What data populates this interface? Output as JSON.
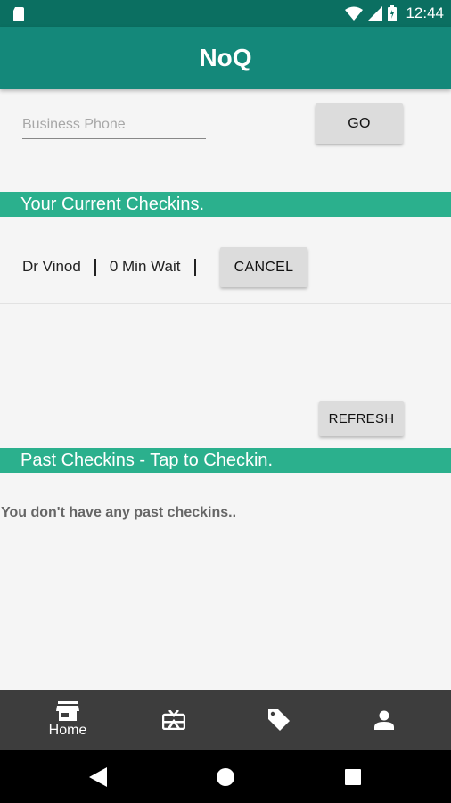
{
  "status_bar": {
    "time": "12:44",
    "icons": [
      "sim-card-icon",
      "wifi-icon",
      "signal-icon",
      "battery-icon"
    ],
    "background": "#0b6f61"
  },
  "app_bar": {
    "title": "NoQ",
    "background": "#14887a"
  },
  "search": {
    "placeholder": "Business Phone",
    "value": "",
    "go_label": "GO"
  },
  "current_checkins": {
    "header": "Your Current Checkins.",
    "items": [
      {
        "name": "Dr Vinod",
        "wait": "0 Min Wait",
        "cancel_label": "CANCEL"
      }
    ]
  },
  "refresh_label": "REFRESH",
  "past_checkins": {
    "header": "Past Checkins - Tap to Checkin.",
    "empty_message": "You don't have any past checkins.."
  },
  "bottom_nav": {
    "items": [
      {
        "label": "Home",
        "icon": "store-icon",
        "selected": true
      },
      {
        "label": "",
        "icon": "gift-card-icon",
        "selected": false
      },
      {
        "label": "",
        "icon": "tag-icon",
        "selected": false
      },
      {
        "label": "",
        "icon": "person-icon",
        "selected": false
      }
    ],
    "background": "#3d3d3d"
  },
  "colors": {
    "accent": "#2bb08d",
    "button": "#dcdcdc"
  }
}
